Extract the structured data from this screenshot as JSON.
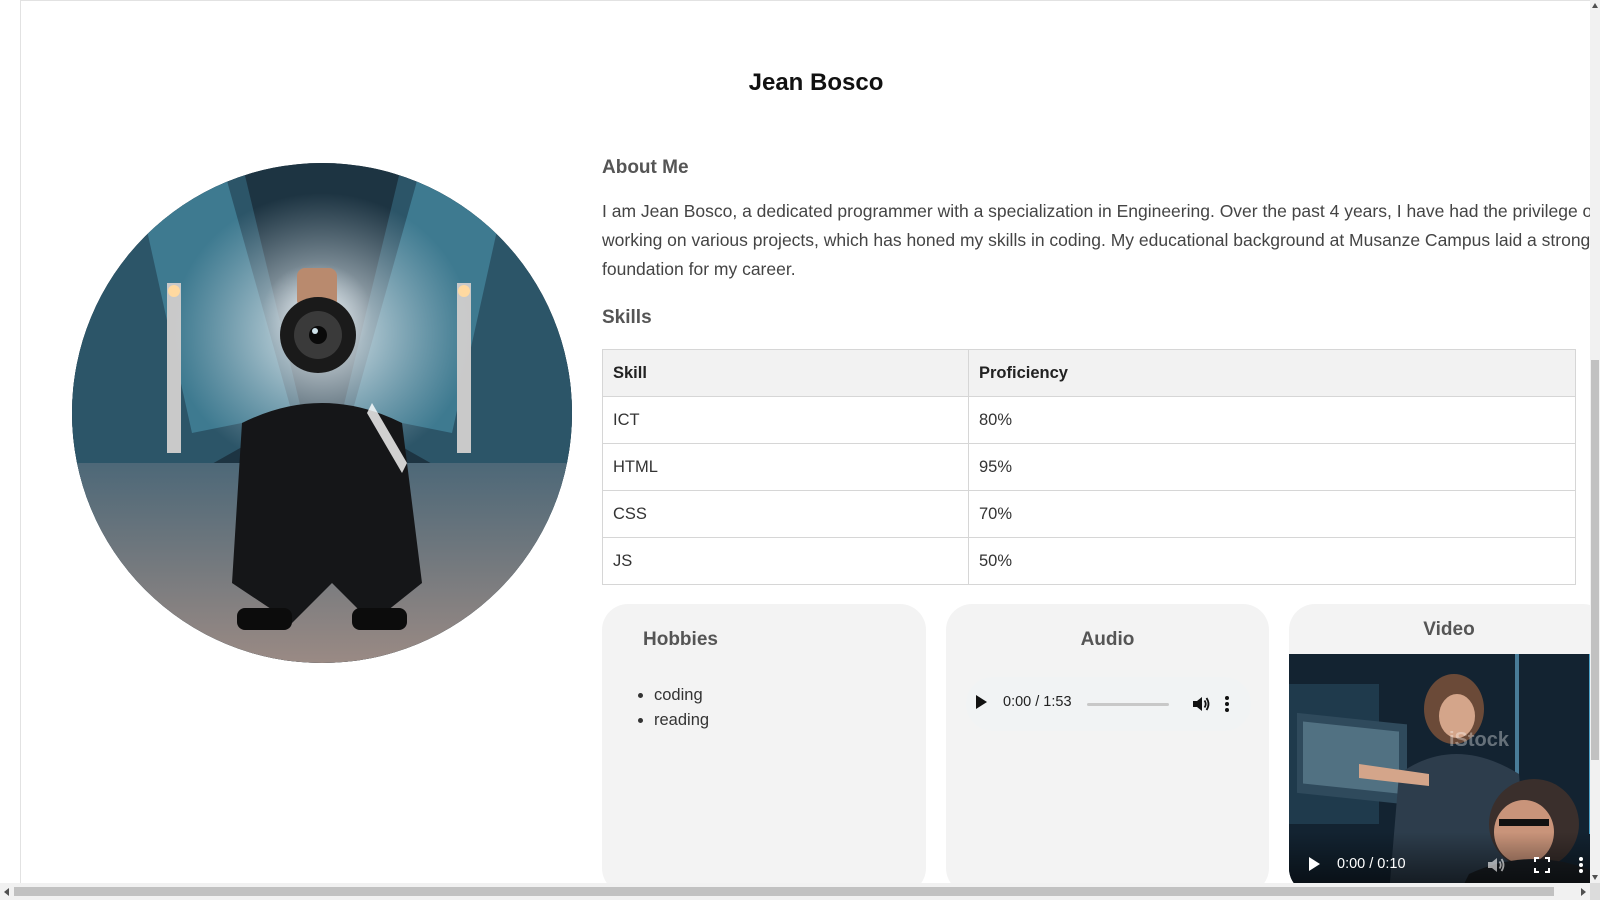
{
  "page": {
    "title": "Jean Bosco"
  },
  "about": {
    "heading": "About Me",
    "text": "I am Jean Bosco, a dedicated programmer with a specialization in Engineering. Over the past 4 years, I have had the privilege of working on various projects, which has honed my skills in coding. My educational background at Musanze Campus laid a strong foundation for my career."
  },
  "skills": {
    "heading": "Skills",
    "headers": [
      "Skill",
      "Proficiency"
    ],
    "rows": [
      [
        "ICT",
        "80%"
      ],
      [
        "HTML",
        "95%"
      ],
      [
        "CSS",
        "70%"
      ],
      [
        "JS",
        "50%"
      ]
    ]
  },
  "hobbies": {
    "heading": "Hobbies",
    "items": [
      "coding",
      "reading"
    ]
  },
  "audio": {
    "heading": "Audio",
    "time": "0:00 / 1:53"
  },
  "video": {
    "heading": "Video",
    "time": "0:00 / 0:10"
  },
  "colors": {
    "panel_bg": "#f3f3f3",
    "table_header_bg": "#f2f2f2",
    "text": "#333333"
  },
  "icons": {
    "audio_play": "play-icon",
    "audio_volume": "volume-icon",
    "audio_menu": "more-vertical-icon",
    "video_play": "play-icon",
    "video_mute": "mute-icon",
    "video_fullscreen": "fullscreen-icon",
    "video_menu": "more-vertical-icon"
  }
}
